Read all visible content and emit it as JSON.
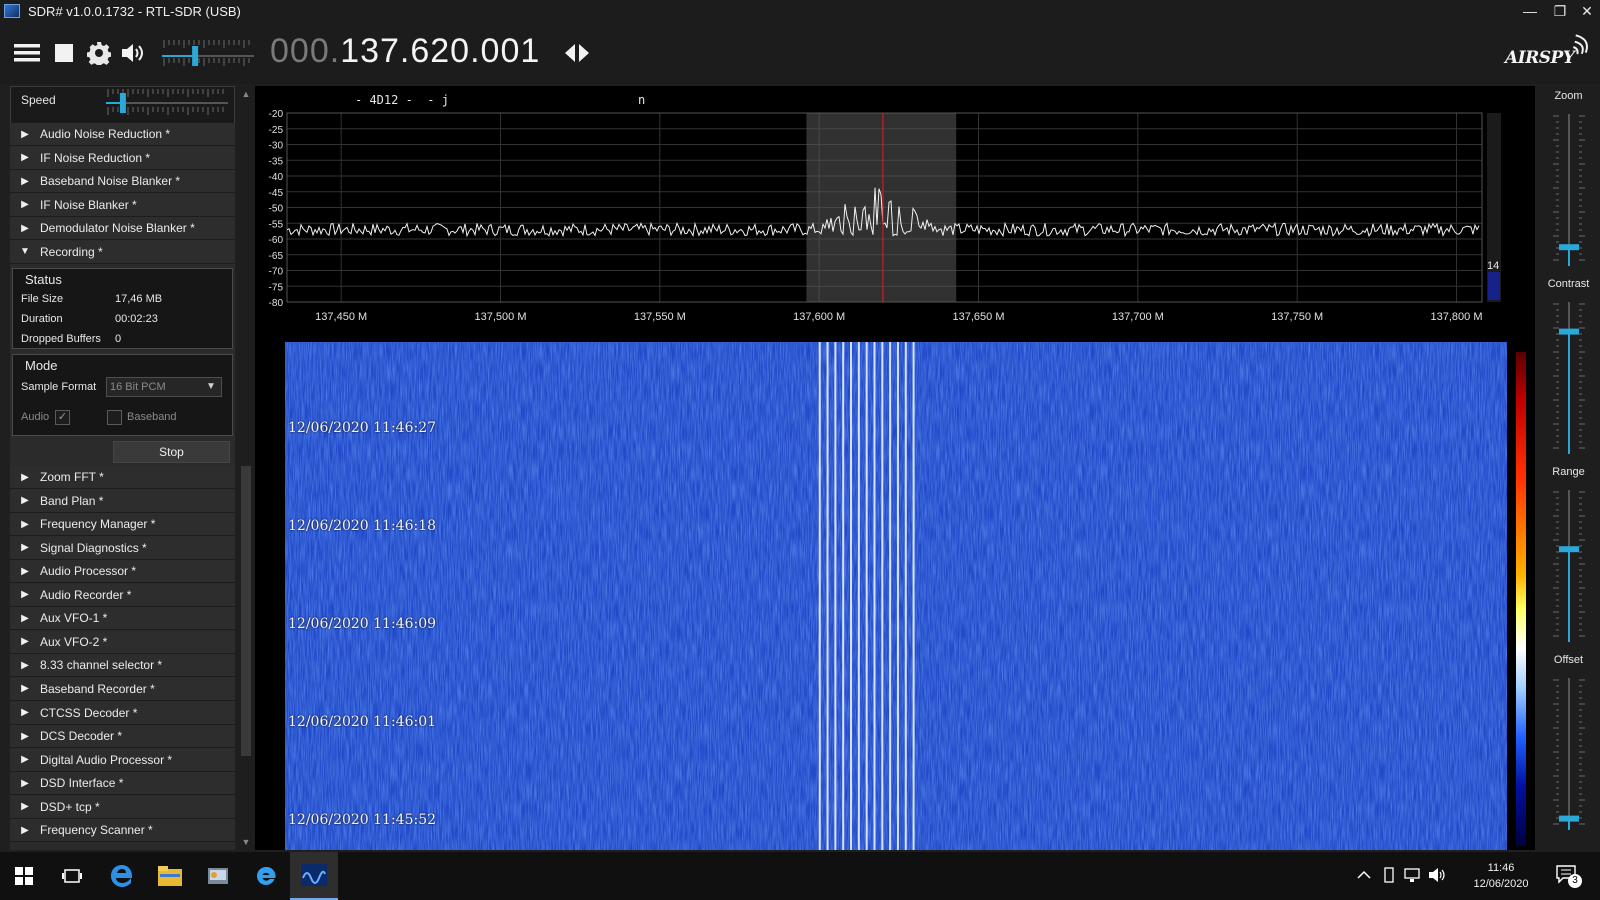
{
  "window": {
    "title": "SDR# v1.0.0.1732 - RTL-SDR (USB)",
    "minimize": "—",
    "restore": "❐",
    "close": "✕"
  },
  "toolbar": {
    "menu_icon": "hamburger-menu-icon",
    "stop_icon": "stop-square-icon",
    "settings_icon": "gear-icon",
    "volume_icon": "speaker-icon",
    "volume_level": 0.35,
    "frequency_dim": "000.",
    "frequency_main": "137.620.001",
    "tune_icon": "left-right-arrows-icon",
    "logo_text": "AIRSPY"
  },
  "left_panel": {
    "speed": {
      "label": "Speed",
      "level": 0.12
    },
    "plugins_top": [
      {
        "label": "Audio Noise Reduction *",
        "expanded": false
      },
      {
        "label": "IF Noise Reduction *",
        "expanded": false
      },
      {
        "label": "Baseband Noise Blanker *",
        "expanded": false
      },
      {
        "label": "IF Noise Blanker *",
        "expanded": false
      },
      {
        "label": "Demodulator Noise Blanker *",
        "expanded": false
      },
      {
        "label": "Recording *",
        "expanded": true
      }
    ],
    "recording": {
      "status_title": "Status",
      "file_size_label": "File Size",
      "file_size": "17,46 MB",
      "duration_label": "Duration",
      "duration": "00:02:23",
      "dropped_label": "Dropped Buffers",
      "dropped": "0",
      "mode_title": "Mode",
      "sample_format_label": "Sample Format",
      "sample_format": "16 Bit PCM",
      "audio_label": "Audio",
      "audio_checked": true,
      "baseband_label": "Baseband",
      "baseband_checked": false,
      "stop_label": "Stop"
    },
    "plugins_bottom": [
      {
        "label": "Zoom FFT *"
      },
      {
        "label": "Band Plan *"
      },
      {
        "label": "Frequency Manager *"
      },
      {
        "label": "Signal Diagnostics *"
      },
      {
        "label": "Audio Processor *"
      },
      {
        "label": "Audio Recorder *"
      },
      {
        "label": "Aux VFO-1 *"
      },
      {
        "label": "Aux VFO-2 *"
      },
      {
        "label": "8.33 channel selector *"
      },
      {
        "label": "Baseband Recorder *"
      },
      {
        "label": "CTCSS Decoder *"
      },
      {
        "label": "DCS Decoder *"
      },
      {
        "label": "Digital Audio Processor *"
      },
      {
        "label": "DSD Interface *"
      },
      {
        "label": "DSD+ tcp *"
      },
      {
        "label": "Frequency Scanner *"
      }
    ]
  },
  "spectrum": {
    "vfo_text_1": "- 4D12 -  - j",
    "vfo_text_2": "n",
    "db_ticks": [
      "-20",
      "-25",
      "-30",
      "-35",
      "-40",
      "-45",
      "-50",
      "-55",
      "-60",
      "-65",
      "-70",
      "-75",
      "-80"
    ],
    "freq_ticks": [
      "137,450 M",
      "137,500 M",
      "137,550 M",
      "137,600 M",
      "137,650 M",
      "137,700 M",
      "137,750 M",
      "137,800 M"
    ],
    "freq_tick_values": [
      137.45,
      137.5,
      137.55,
      137.6,
      137.65,
      137.7,
      137.75,
      137.8
    ],
    "freq_range": [
      137.433,
      137.808
    ],
    "db_range": [
      -80,
      -20
    ],
    "center_freq": 137.62,
    "filter_range": [
      137.596,
      137.643
    ],
    "noise_floor_db": -57,
    "scale_number": "14"
  },
  "waterfall": {
    "timestamps": [
      "12/06/2020 11:46:27",
      "12/06/2020 11:46:18",
      "12/06/2020 11:46:09",
      "12/06/2020 11:46:01",
      "12/06/2020 11:45:52"
    ]
  },
  "right_panel": {
    "zoom_label": "Zoom",
    "contrast_label": "Contrast",
    "range_label": "Range",
    "offset_label": "Offset",
    "zoom_level": 0.05,
    "contrast_level": 0.8,
    "range_level": 0.6,
    "offset_level": 0.05
  },
  "taskbar": {
    "start_icon": "windows-start-icon",
    "taskview_icon": "task-view-icon",
    "edge_icon": "edge-browser-icon",
    "explorer_icon": "file-explorer-icon",
    "app_icon": "application-icon",
    "ie_icon": "internet-explorer-icon",
    "sdr_icon": "sdrsharp-icon",
    "time": "11:46",
    "date": "12/06/2020",
    "notifications": "3"
  }
}
